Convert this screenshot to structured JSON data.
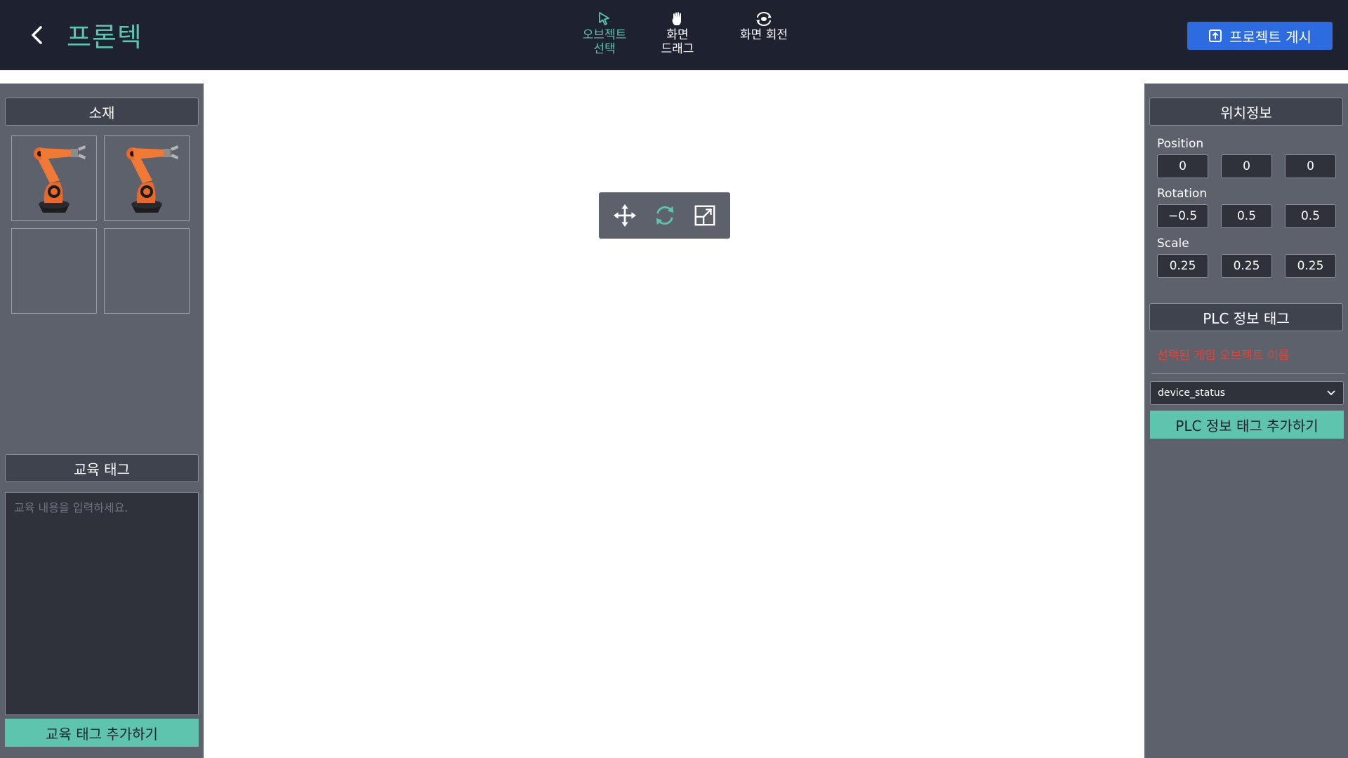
{
  "header": {
    "title": "프론텍",
    "tools": [
      {
        "label": "오브젝트\n선택",
        "icon": "cursor-icon",
        "active": true
      },
      {
        "label": "화면\n드래그",
        "icon": "hand-icon",
        "active": false
      },
      {
        "label": "화면 회전",
        "icon": "rotate-view-icon",
        "active": false
      }
    ],
    "publish_label": "프로젝트 게시"
  },
  "left": {
    "assets_title": "소재",
    "assets": [
      {
        "icon": "robot-arm-thumbnail"
      },
      {
        "icon": "robot-arm-thumbnail"
      },
      {
        "icon": ""
      },
      {
        "icon": ""
      }
    ],
    "edu_title": "교육 태그",
    "edu_placeholder": "교육 내용을 입력하세요.",
    "edu_button": "교육 태그 추가하기"
  },
  "viewport": {
    "gizmo_tools": [
      {
        "icon": "move-icon",
        "active": false
      },
      {
        "icon": "rotate-icon",
        "active": true
      },
      {
        "icon": "scale-icon",
        "active": false
      }
    ]
  },
  "right": {
    "position_title": "위치정보",
    "position_label": "Position",
    "position": [
      "0",
      "0",
      "0"
    ],
    "rotation_label": "Rotation",
    "rotation": [
      "−0.5",
      "0.5",
      "0.5"
    ],
    "scale_label": "Scale",
    "scale": [
      "0.25",
      "0.25",
      "0.25"
    ],
    "plc_title": "PLC 정보 태그",
    "selected_object_name": "선택된 게임 오브젝트 이름",
    "plc_select_value": "device_status",
    "plc_button": "PLC 정보 태그 추가하기"
  },
  "colors": {
    "accent": "#5ec4ad",
    "topbar": "#1e2130",
    "panel": "#5d616c",
    "publish": "#2d6be0",
    "warning_text": "#e0453a"
  }
}
